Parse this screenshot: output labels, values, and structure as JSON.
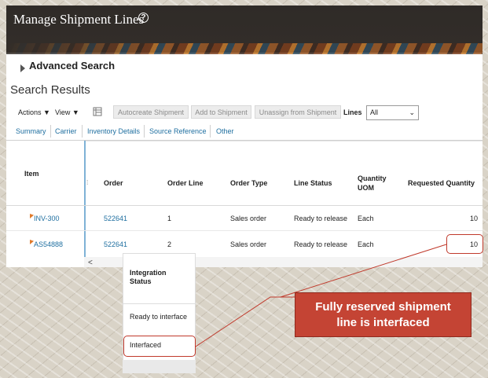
{
  "header": {
    "title": "Manage Shipment Lines",
    "help_icon": "?"
  },
  "advanced_search": {
    "label": "Advanced Search"
  },
  "search_results": {
    "title": "Search Results"
  },
  "toolbar": {
    "actions_label": "Actions ▼",
    "view_label": "View ▼",
    "freeze_icon": "freeze-columns-icon",
    "buttons": [
      "Autocreate Shipment",
      "Add to Shipment",
      "Unassign from Shipment"
    ],
    "lines_label": "Lines",
    "lines_value": "All"
  },
  "tabs": [
    "Summary",
    "Carrier",
    "Inventory Details",
    "Source Reference",
    "Other"
  ],
  "table": {
    "columns": {
      "item": "Item",
      "order": "Order",
      "order_line": "Order Line",
      "order_type": "Order Type",
      "line_status": "Line Status",
      "quantity_uom_1": "Quantity",
      "quantity_uom_2": "UOM",
      "requested_quantity": "Requested Quantity"
    },
    "rows": [
      {
        "item": "INV-300",
        "order": "522641",
        "order_line": "1",
        "order_type": "Sales order",
        "line_status": "Ready to release",
        "uom": "Each",
        "requested_quantity": "10"
      },
      {
        "item": "AS54888",
        "order": "522641",
        "order_line": "2",
        "order_type": "Sales order",
        "line_status": "Ready to release",
        "uom": "Each",
        "requested_quantity": "10"
      }
    ]
  },
  "callout": {
    "header_1": "Integration",
    "header_2": "Status",
    "values": [
      "Ready to interface",
      "Interfaced"
    ]
  },
  "banner": {
    "line1": "Fully reserved shipment",
    "line2": "line is interfaced"
  },
  "colors": {
    "accent": "#c44434",
    "link": "#1f6fa0",
    "header_bg": "#322d29"
  }
}
